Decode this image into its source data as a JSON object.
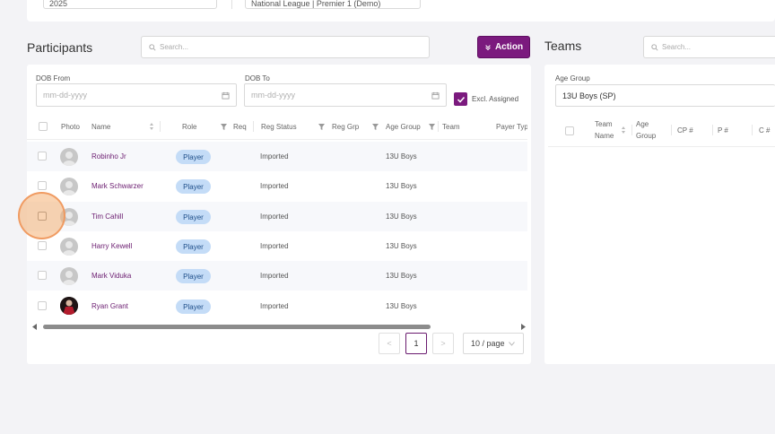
{
  "top": {
    "select1": "2025",
    "select2": "National League | Premier 1 (Demo)"
  },
  "participants": {
    "title": "Participants",
    "search_placeholder": "Search...",
    "action_label": "Action",
    "dob_from_label": "DOB From",
    "dob_to_label": "DOB To",
    "date_placeholder": "mm-dd-yyyy",
    "excl_assigned_label": "Excl. Assigned",
    "excl_assigned_checked": true,
    "columns": [
      "Photo",
      "Name",
      "Role",
      "Req",
      "Reg Status",
      "Reg Grp",
      "Age Group",
      "Team",
      "Payer Typ"
    ],
    "rows": [
      {
        "name": "Robinho Jr",
        "role": "Player",
        "status": "Imported",
        "age_group": "13U Boys"
      },
      {
        "name": "Mark Schwarzer",
        "role": "Player",
        "status": "Imported",
        "age_group": "13U Boys"
      },
      {
        "name": "Tim Cahill",
        "role": "Player",
        "status": "Imported",
        "age_group": "13U Boys"
      },
      {
        "name": "Harry Kewell",
        "role": "Player",
        "status": "Imported",
        "age_group": "13U Boys"
      },
      {
        "name": "Mark Viduka",
        "role": "Player",
        "status": "Imported",
        "age_group": "13U Boys"
      },
      {
        "name": "Ryan Grant",
        "role": "Player",
        "status": "Imported",
        "age_group": "13U Boys"
      }
    ],
    "pagination": {
      "prev": "<",
      "current": "1",
      "next": ">",
      "page_size": "10 / page"
    }
  },
  "teams": {
    "title": "Teams",
    "search_placeholder": "Search...",
    "age_group_label": "Age Group",
    "age_group_value": "13U Boys (SP)",
    "columns": {
      "team_name_1": "Team",
      "team_name_2": "Name",
      "age_group_1": "Age",
      "age_group_2": "Group",
      "cp": "CP #",
      "p": "P #",
      "c": "C #"
    }
  },
  "colors": {
    "accent": "#7b1a7e",
    "role_pill": "#c4dcf7",
    "highlight": "#f4b074"
  }
}
